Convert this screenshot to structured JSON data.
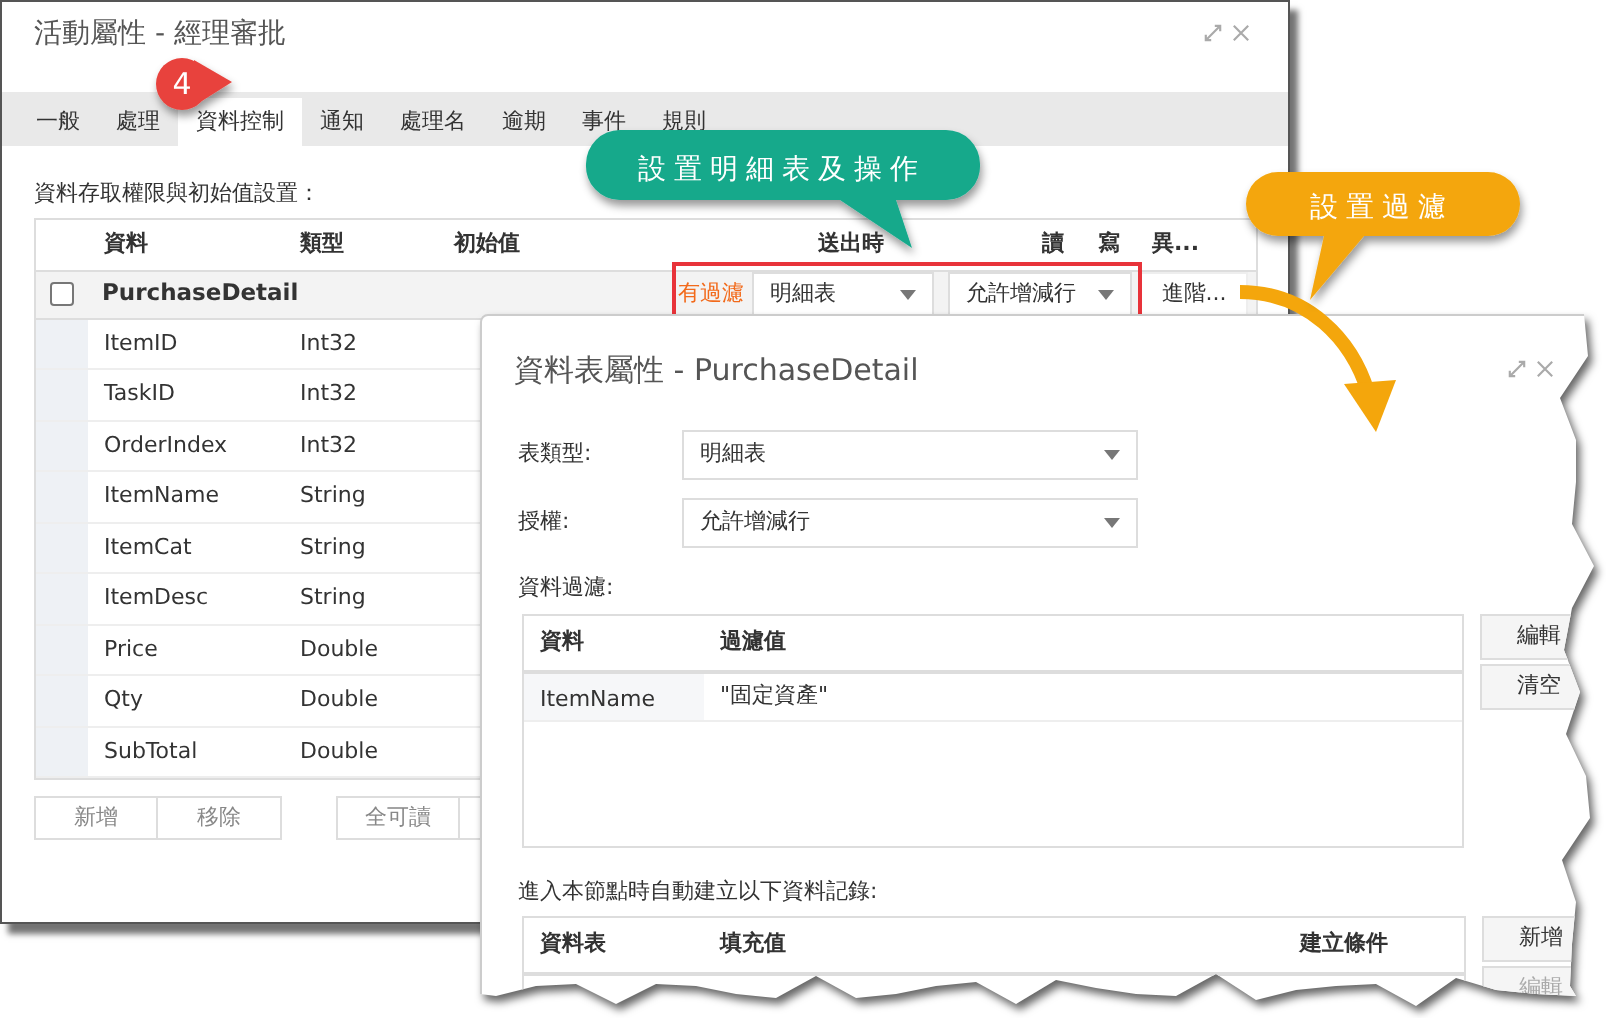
{
  "main_dialog": {
    "title": "活動屬性 - 經理審批",
    "tabs": [
      {
        "label": "一般",
        "selected": false
      },
      {
        "label": "處理",
        "selected": false
      },
      {
        "label": "資料控制",
        "selected": true
      },
      {
        "label": "通知",
        "selected": false
      },
      {
        "label": "處理名",
        "selected": false
      },
      {
        "label": "逾期",
        "selected": false
      },
      {
        "label": "事件",
        "selected": false
      },
      {
        "label": "規則",
        "selected": false
      }
    ],
    "section_label": "資料存取權限與初始值設置：",
    "table": {
      "columns": [
        "資料",
        "類型",
        "初始值",
        "送出時",
        "讀",
        "寫",
        "異..."
      ],
      "detail_row": {
        "checked": false,
        "name": "PurchaseDetail",
        "filter_flag": "有過濾",
        "table_type": "明細表",
        "permission": "允許增減行",
        "advanced_button": "進階..."
      },
      "rows": [
        {
          "name": "ItemID",
          "type": "Int32"
        },
        {
          "name": "TaskID",
          "type": "Int32"
        },
        {
          "name": "OrderIndex",
          "type": "Int32"
        },
        {
          "name": "ItemName",
          "type": "String"
        },
        {
          "name": "ItemCat",
          "type": "String"
        },
        {
          "name": "ItemDesc",
          "type": "String"
        },
        {
          "name": "Price",
          "type": "Double"
        },
        {
          "name": "Qty",
          "type": "Double"
        },
        {
          "name": "SubTotal",
          "type": "Double"
        }
      ]
    },
    "buttons": [
      "新增",
      "移除",
      "全可讀"
    ]
  },
  "detail_dialog": {
    "title": "資料表屬性 - PurchaseDetail",
    "fields": [
      {
        "label": "表類型:",
        "value": "明細表"
      },
      {
        "label": "授權:",
        "value": "允許增減行"
      }
    ],
    "filter": {
      "label": "資料過濾:",
      "columns": [
        "資料",
        "過濾值"
      ],
      "rows": [
        {
          "data": "ItemName",
          "value": "\"固定資產\""
        }
      ],
      "buttons": [
        {
          "label": "編輯",
          "disabled": false
        },
        {
          "label": "清空",
          "disabled": false
        }
      ]
    },
    "records": {
      "label": "進入本節點時自動建立以下資料記錄:",
      "columns": [
        "資料表",
        "填充值",
        "建立條件"
      ],
      "buttons": [
        {
          "label": "新增",
          "disabled": false
        },
        {
          "label": "編輯",
          "disabled": true
        }
      ]
    }
  },
  "callouts": [
    {
      "kind": "badge",
      "text": "4",
      "color": "#e8433d"
    },
    {
      "kind": "bubble",
      "text": "設置明細表及操作",
      "color": "#14a98b"
    },
    {
      "kind": "bubble",
      "text": "設置過濾",
      "color": "#f4a60c"
    }
  ]
}
